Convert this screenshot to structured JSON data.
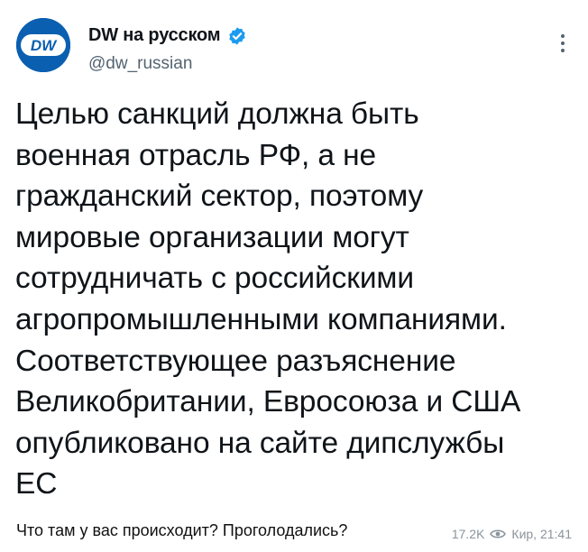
{
  "tweet": {
    "display_name": "DW на русском",
    "handle": "@dw_russian",
    "avatar_logo_text": "DW",
    "text": "Целью санкций должна быть\nвоенная отрасль РФ, а не\nгражданский сектор, поэтому\nмировые организации могут\nсотрудничать с российскими\nагропромышленными компаниями.\nСоответствующее разъяснение\nВеликобритании, Евросоюза и США\nопубликовано на сайте дипслужбы\nЕС",
    "verified_color": "#1d9bf0",
    "avatar_color": "#0a5fb0"
  },
  "post_footer": {
    "caption": "Что там у вас происходит? Проголодались?",
    "views": "17.2K",
    "author_time": "Кир, 21:41"
  }
}
